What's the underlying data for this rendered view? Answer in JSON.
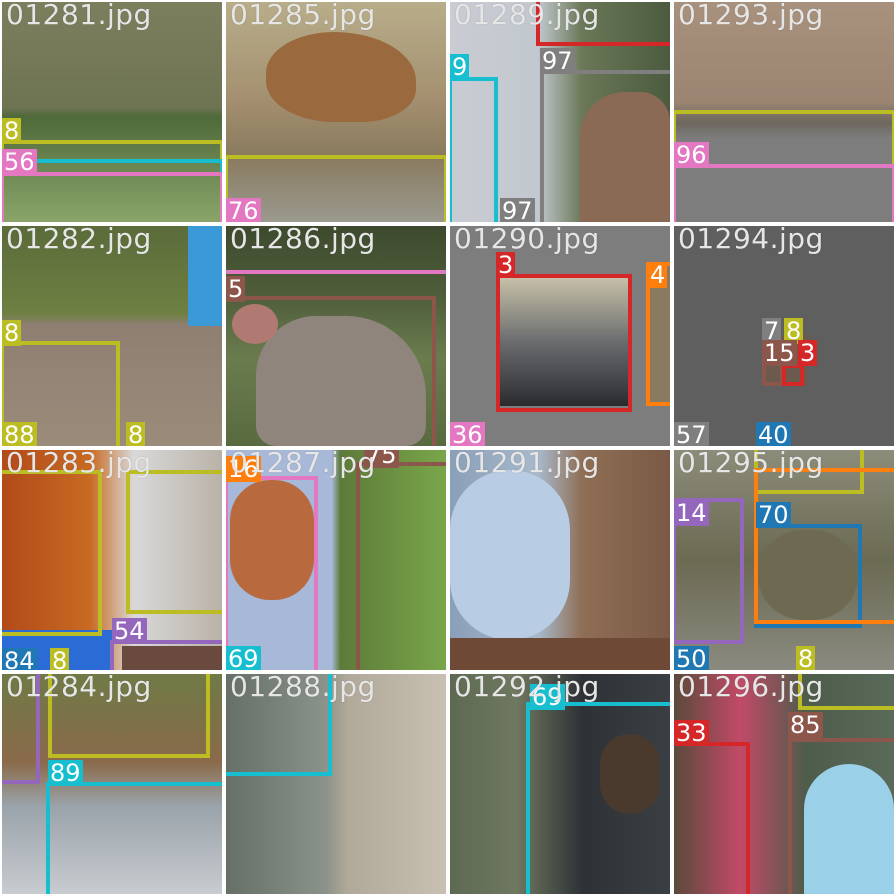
{
  "colors": {
    "olive": "#bcbd22",
    "cyan": "#17becf",
    "pink": "#e377c2",
    "red": "#d62728",
    "gray": "#7f7f7f",
    "brown": "#8c564b",
    "orange": "#ff7f0e",
    "purple": "#9467bd",
    "blue": "#1f77b4"
  },
  "tiles": [
    {
      "file": "01281.jpg",
      "labels": [
        "8",
        "56"
      ]
    },
    {
      "file": "01285.jpg",
      "labels": [
        "76"
      ]
    },
    {
      "file": "01289.jpg",
      "labels": [
        "9",
        "97",
        "97"
      ]
    },
    {
      "file": "01293.jpg",
      "labels": [
        "96"
      ]
    },
    {
      "file": "01282.jpg",
      "labels": [
        "8",
        "88",
        "8"
      ]
    },
    {
      "file": "01286.jpg",
      "labels": [
        "5"
      ]
    },
    {
      "file": "01290.jpg",
      "labels": [
        "3",
        "4",
        "36"
      ]
    },
    {
      "file": "01294.jpg",
      "labels": [
        "7",
        "8",
        "15",
        "3",
        "57",
        "40"
      ]
    },
    {
      "file": "01283.jpg",
      "labels": [
        "54",
        "84",
        "8"
      ]
    },
    {
      "file": "01287.jpg",
      "labels": [
        "16",
        "75",
        "69"
      ]
    },
    {
      "file": "01291.jpg",
      "labels": []
    },
    {
      "file": "01295.jpg",
      "labels": [
        "14",
        "70",
        "50",
        "8"
      ]
    },
    {
      "file": "01284.jpg",
      "labels": [
        "89"
      ]
    },
    {
      "file": "01288.jpg",
      "labels": []
    },
    {
      "file": "01292.jpg",
      "labels": [
        "69"
      ]
    },
    {
      "file": "01296.jpg",
      "labels": [
        "33",
        "85"
      ]
    }
  ]
}
